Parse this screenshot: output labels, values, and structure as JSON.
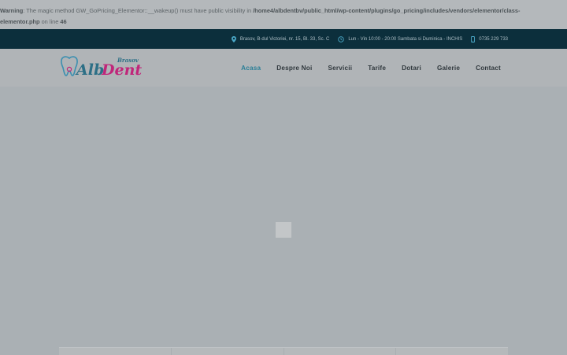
{
  "warning": {
    "label": "Warning",
    "message": ": The magic method GW_GoPricing_Elementor::__wakeup() must have public visibility in ",
    "path_line1": "/home4/albdentbv/public_html/wp-content/plugins/go_pricing/includes/vendors/elementor/class-",
    "path_line2": "elementor.php",
    "on_line": " on line ",
    "line_number": "46"
  },
  "topbar": {
    "address": "Brasov, B-dul Victoriei, nr. 15, Bl. 33, Sc. C",
    "hours": "Lun - Vin 10:00 - 20:00 Sambata si Duminica - INCHIS",
    "phone": "0735 229 733",
    "icons": [
      "map-pin-icon",
      "clock-icon",
      "phone-icon"
    ]
  },
  "logo": {
    "text_main": "Alb Dent",
    "text_city": "Brasov",
    "colors": {
      "alb": "#2c6f86",
      "dent": "#c0267a",
      "tooth": "#3b8fb0"
    }
  },
  "nav": {
    "items": [
      "Acasa",
      "Despre Noi",
      "Servicii",
      "Tarife",
      "Dotari",
      "Galerie",
      "Contact"
    ],
    "active": "Acasa"
  },
  "colors": {
    "topbar_bg": "#0c2f3c",
    "overlay": "#aab0b4",
    "accent": "#2b7f97"
  }
}
